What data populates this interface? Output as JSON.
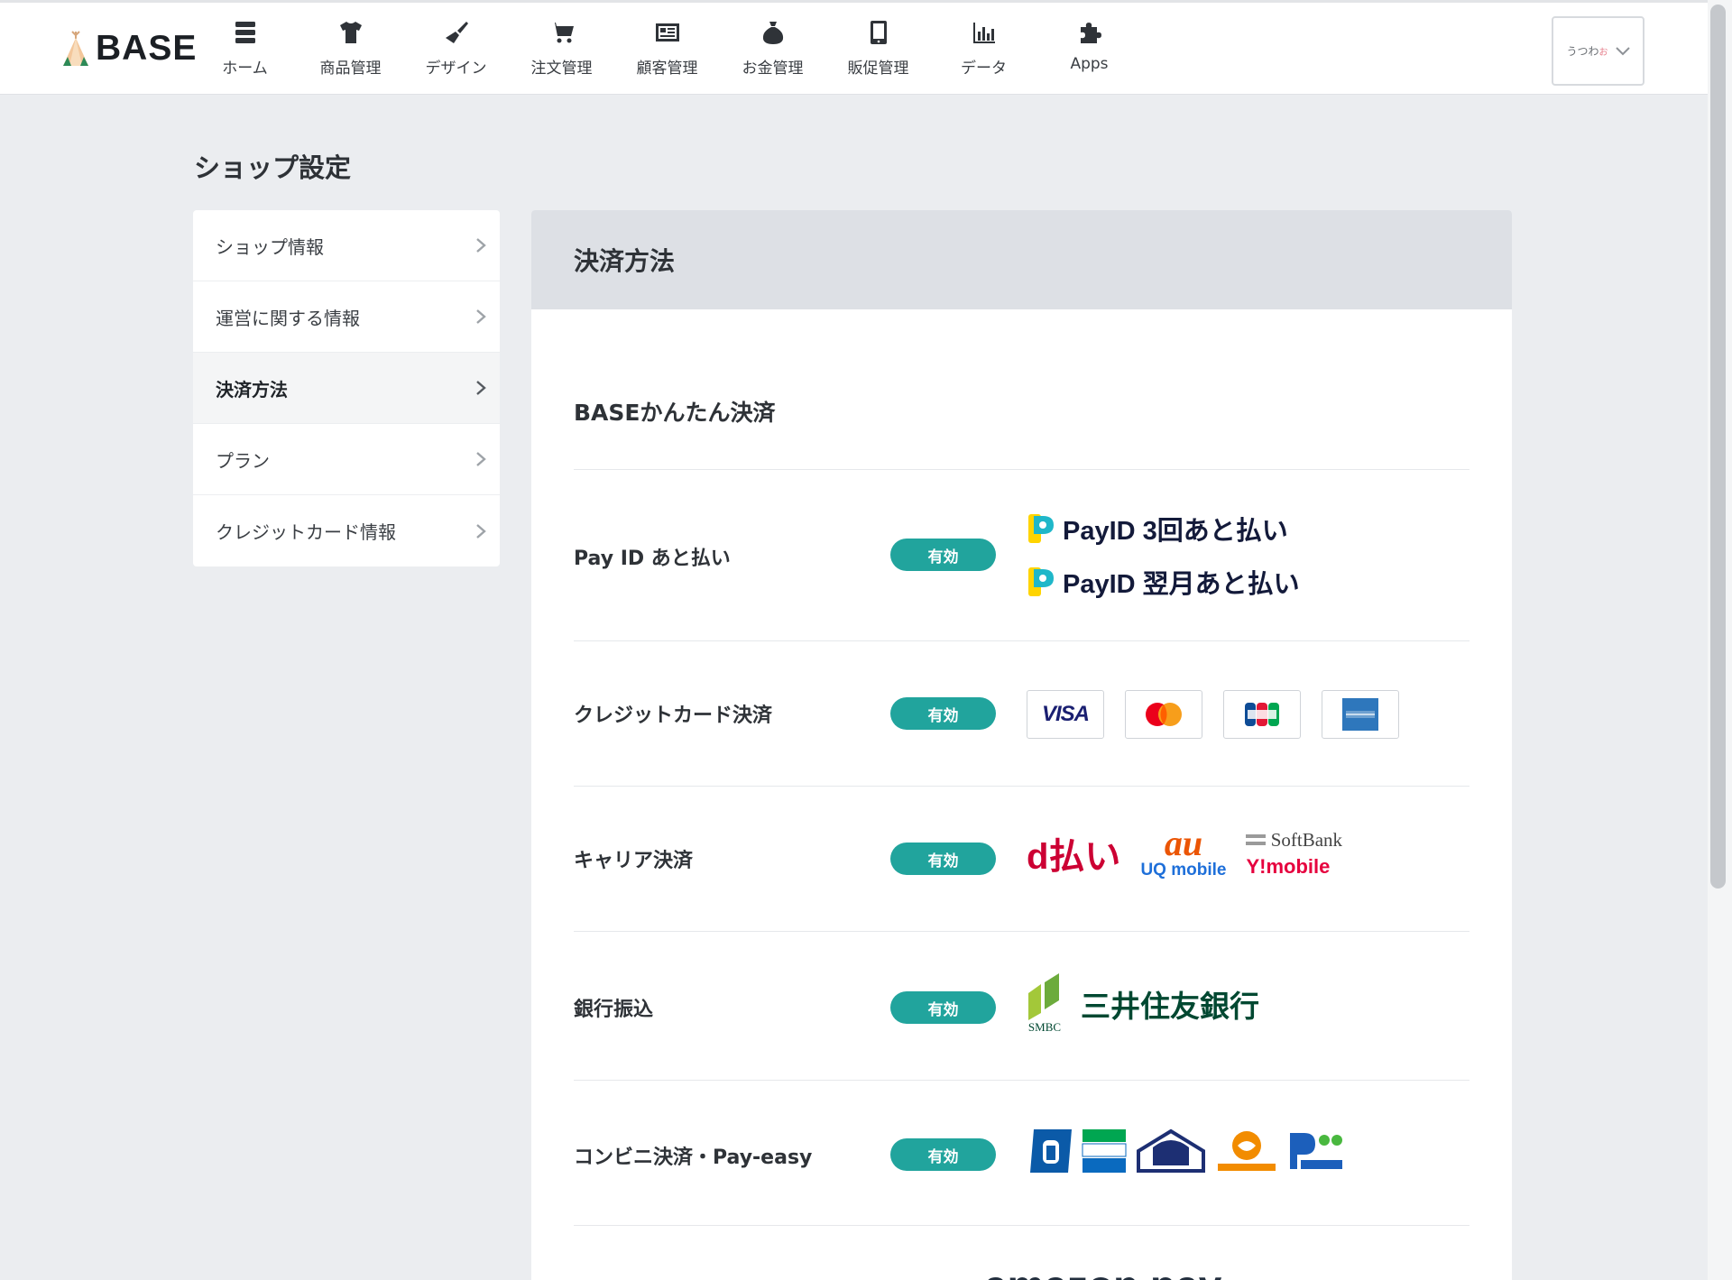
{
  "header": {
    "logo_text": "BASE",
    "nav": [
      {
        "label": "ホーム",
        "icon": "home-icon"
      },
      {
        "label": "商品管理",
        "icon": "tshirt-icon"
      },
      {
        "label": "デザイン",
        "icon": "brush-icon"
      },
      {
        "label": "注文管理",
        "icon": "cart-icon"
      },
      {
        "label": "顧客管理",
        "icon": "contact-card-icon"
      },
      {
        "label": "お金管理",
        "icon": "money-bag-icon"
      },
      {
        "label": "販促管理",
        "icon": "smartphone-icon"
      },
      {
        "label": "データ",
        "icon": "bar-chart-icon"
      },
      {
        "label": "Apps",
        "icon": "puzzle-icon"
      }
    ],
    "shop_name": "うつわ",
    "shop_name_suffix": "お"
  },
  "page": {
    "title": "ショップ設定",
    "side_menu": [
      {
        "label": "ショップ情報",
        "active": false
      },
      {
        "label": "運営に関する情報",
        "active": false
      },
      {
        "label": "決済方法",
        "active": true
      },
      {
        "label": "プラン",
        "active": false
      },
      {
        "label": "クレジットカード情報",
        "active": false
      }
    ]
  },
  "panel": {
    "heading": "決済方法",
    "section_title": "BASEかんたん決済",
    "rows": [
      {
        "label": "Pay ID あと払い",
        "status": "有効"
      },
      {
        "label": "クレジットカード決済",
        "status": "有効"
      },
      {
        "label": "キャリア決済",
        "status": "有効"
      },
      {
        "label": "銀行振込",
        "status": "有効"
      },
      {
        "label": "コンビニ決済・Pay-easy",
        "status": "有効"
      }
    ],
    "payid_logos": [
      "PayID 3回あと払い",
      "PayID 翌月あと払い"
    ],
    "card_brands": [
      "VISA"
    ],
    "carrier_logos": {
      "docomo": "d払い",
      "au": "au",
      "uq": "UQ mobile",
      "softbank": "SoftBank",
      "ymobile": "Y!mobile"
    },
    "bank": {
      "caption": "SMBC",
      "name": "三井住友銀行"
    },
    "amazon_partial": "amazon pay"
  },
  "colors": {
    "accent_teal": "#21a49d",
    "page_bg": "#ebedf0",
    "panel_header_bg": "#dde0e5"
  }
}
